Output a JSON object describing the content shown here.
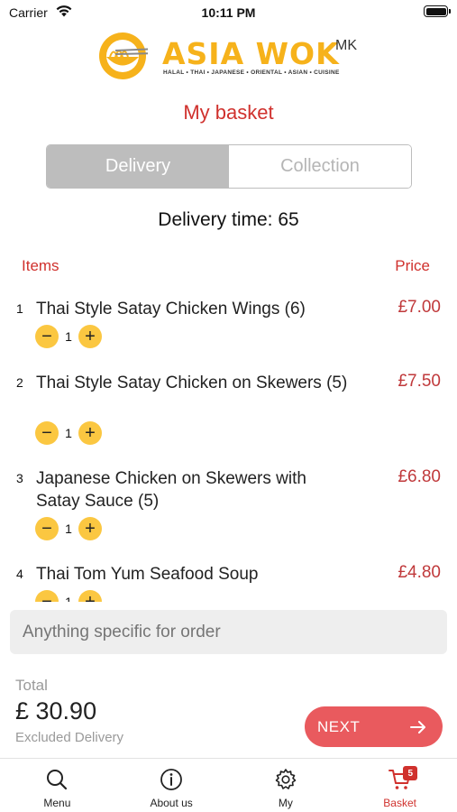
{
  "status_bar": {
    "carrier": "Carrier",
    "time": "10:11 PM"
  },
  "brand": {
    "name": "ASIA WOK",
    "suffix": "MK",
    "tagline": "HALAL • THAI • JAPANESE • ORIENTAL • ASIAN • CUISINE",
    "primary_color": "#F6B21B"
  },
  "page_title": "My basket",
  "segments": {
    "delivery": "Delivery",
    "collection": "Collection",
    "selected": "Delivery"
  },
  "delivery_time": "Delivery time: 65",
  "columns": {
    "items": "Items",
    "price": "Price"
  },
  "items": [
    {
      "index": "1",
      "name": "Thai Style Satay Chicken Wings (6)",
      "price": "£7.00",
      "qty": "1"
    },
    {
      "index": "2",
      "name": "Thai Style Satay Chicken on Skewers (5)",
      "price": "£7.50",
      "qty": "1"
    },
    {
      "index": "3",
      "name": "Japanese Chicken on Skewers with Satay Sauce (5)",
      "price": "£6.80",
      "qty": "1"
    },
    {
      "index": "4",
      "name": "Thai Tom Yum Seafood Soup",
      "price": "£4.80",
      "qty": "1"
    }
  ],
  "note": {
    "placeholder": "Anything specific for order"
  },
  "total": {
    "label": "Total",
    "value": "£ 30.90",
    "note": "Excluded Delivery"
  },
  "next_button": {
    "label": "NEXT"
  },
  "tabs": [
    {
      "label": "Menu",
      "icon": "search-icon"
    },
    {
      "label": "About us",
      "icon": "info-icon"
    },
    {
      "label": "My",
      "icon": "gear-icon"
    },
    {
      "label": "Basket",
      "icon": "cart-icon",
      "badge": "5",
      "active": true
    }
  ],
  "colors": {
    "accent_red": "#D0312D",
    "stepper_yellow": "#FBC741",
    "next_button": "#E95A5E"
  }
}
